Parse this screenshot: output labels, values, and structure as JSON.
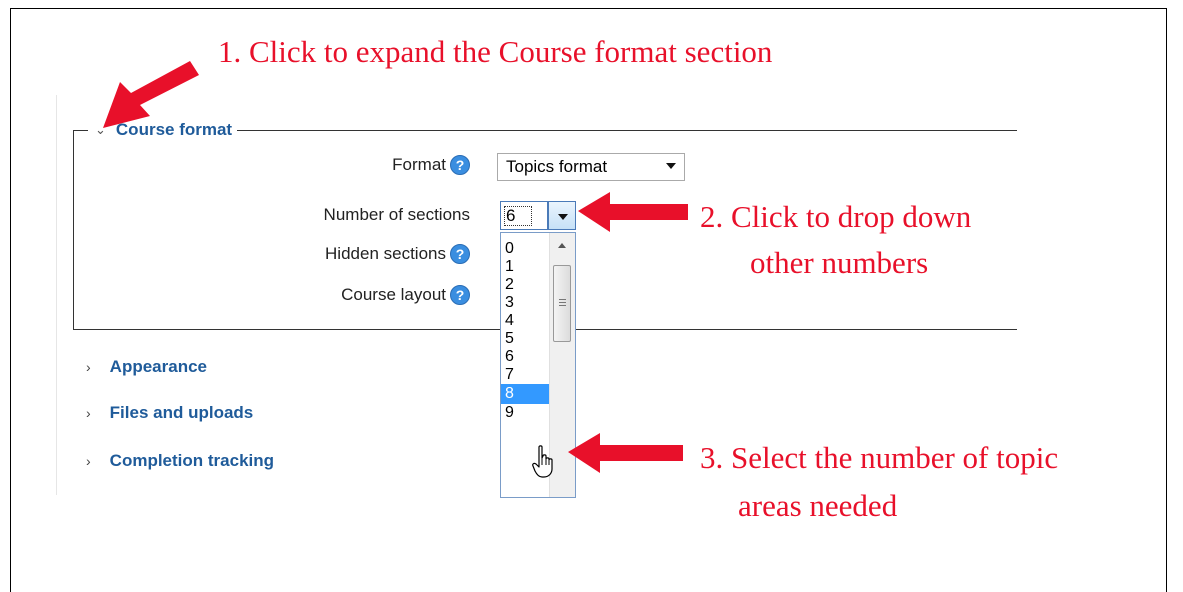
{
  "callouts": {
    "step1": "1. Click to expand the Course format section",
    "step2_line1": "2.  Click to drop down",
    "step2_line2": "other numbers",
    "step3_line1": "3. Select the number of topic",
    "step3_line2": "areas needed"
  },
  "course_format": {
    "legend": "Course format",
    "fields": {
      "format_label": "Format",
      "format_value": "Topics format",
      "sections_label": "Number of sections",
      "sections_value": "6",
      "hidden_label": "Hidden sections",
      "layout_label": "Course layout"
    },
    "help_glyph": "?"
  },
  "dropdown": {
    "options": [
      "0",
      "1",
      "2",
      "3",
      "4",
      "5",
      "6",
      "7",
      "8",
      "9"
    ],
    "highlighted": "8"
  },
  "sections": {
    "appearance": "Appearance",
    "files": "Files and uploads",
    "completion": "Completion tracking"
  },
  "colors": {
    "callout_red": "#e8102a",
    "link_blue": "#1f5b9a",
    "help_blue": "#3a8ee0",
    "highlight": "#3399ff"
  },
  "icons": {
    "expand": "chevron-down-icon",
    "collapse": "chevron-right-icon",
    "help": "help-icon",
    "pointer": "hand-cursor-icon"
  }
}
